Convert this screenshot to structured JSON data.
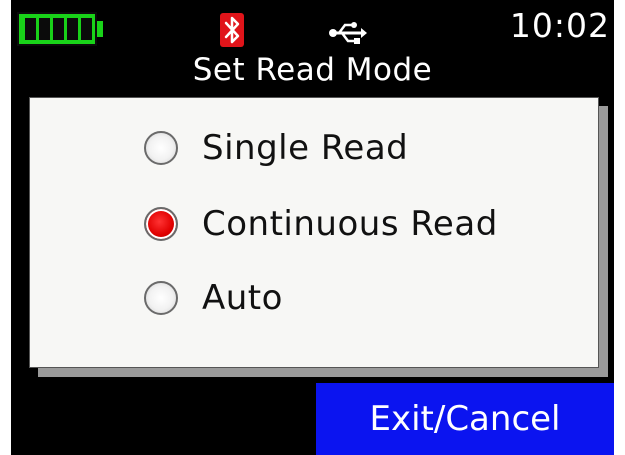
{
  "status": {
    "battery_icon": "battery-full-icon",
    "bluetooth_icon": "bluetooth-icon",
    "usb_icon": "usb-icon",
    "clock": "10:02",
    "colors": {
      "battery": "#19d319",
      "bluetooth": "#e0141a"
    }
  },
  "title": "Set Read Mode",
  "options": [
    {
      "label": "Single Read",
      "selected": false
    },
    {
      "label": "Continuous Read",
      "selected": true
    },
    {
      "label": "Auto",
      "selected": false
    }
  ],
  "exit_button": {
    "label": "Exit/Cancel",
    "color": "#0b14f0"
  }
}
